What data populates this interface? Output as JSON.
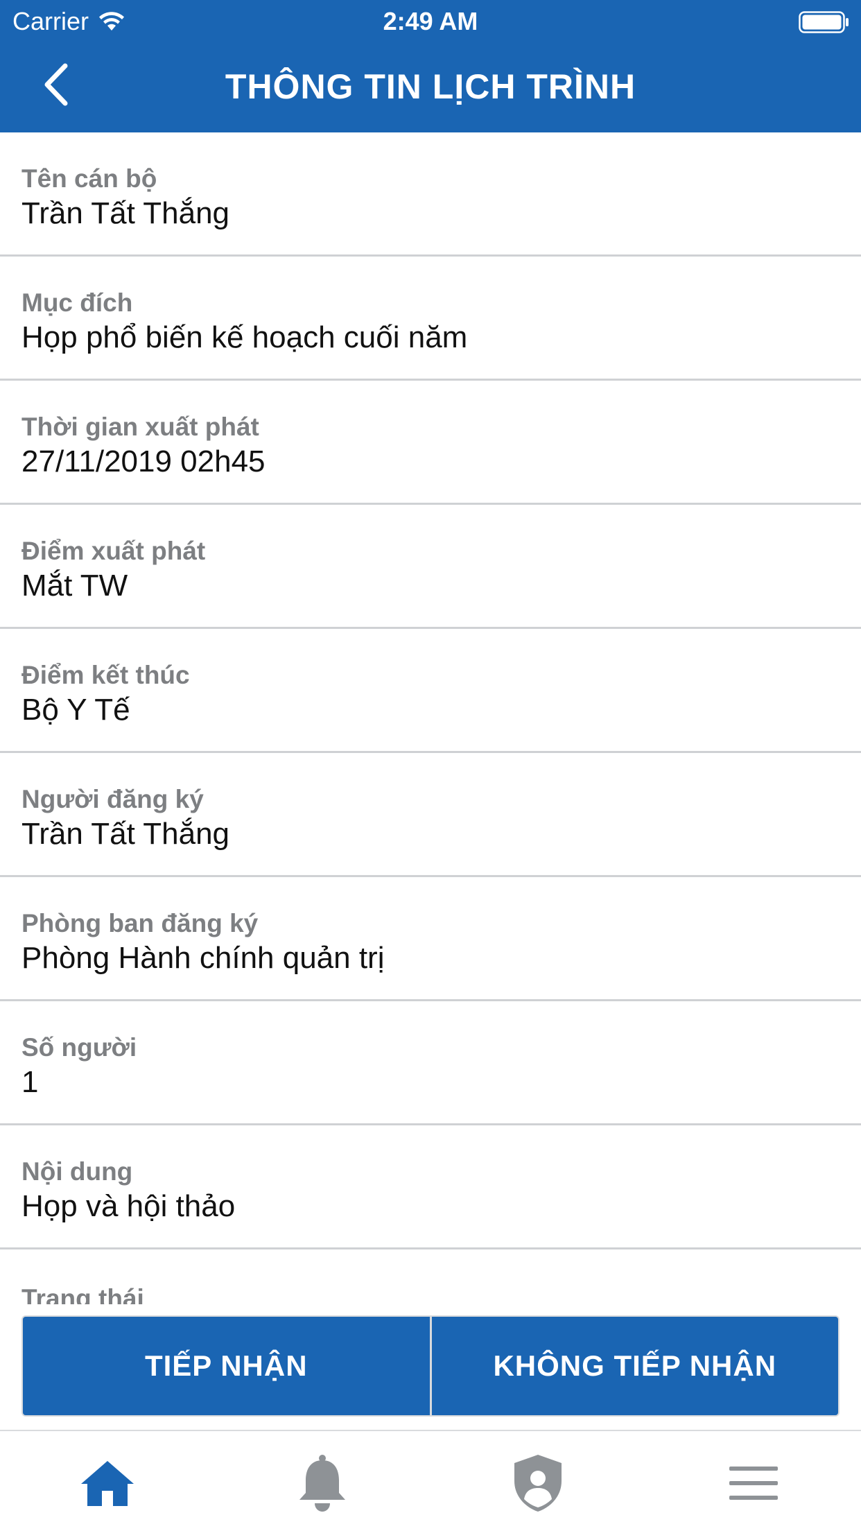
{
  "status_bar": {
    "carrier": "Carrier",
    "time": "2:49 AM"
  },
  "nav": {
    "title": "THÔNG TIN LỊCH TRÌNH"
  },
  "fields": [
    {
      "label": "Tên cán bộ",
      "value": "Trần Tất Thắng"
    },
    {
      "label": "Mục đích",
      "value": "Họp phổ biến kế hoạch cuối năm"
    },
    {
      "label": "Thời gian xuất phát",
      "value": "27/11/2019 02h45"
    },
    {
      "label": "Điểm xuất phát",
      "value": "Mắt TW"
    },
    {
      "label": "Điểm kết thúc",
      "value": "Bộ Y Tế"
    },
    {
      "label": "Người đăng ký",
      "value": "Trần Tất Thắng"
    },
    {
      "label": "Phòng ban đăng ký",
      "value": "Phòng Hành chính quản trị"
    },
    {
      "label": "Số người",
      "value": "1"
    },
    {
      "label": "Nội dung",
      "value": "Họp và hội thảo"
    },
    {
      "label": "Trạng thái",
      "value": ""
    }
  ],
  "actions": {
    "accept_label": "TIẾP NHẬN",
    "reject_label": "KHÔNG TIẾP NHẬN"
  },
  "tabs": [
    {
      "icon": "home-icon",
      "active": true
    },
    {
      "icon": "bell-icon",
      "active": false
    },
    {
      "icon": "shield-user-icon",
      "active": false
    },
    {
      "icon": "menu-icon",
      "active": false
    }
  ],
  "colors": {
    "primary": "#1a65b3",
    "label": "#7d7f82",
    "inactive_icon": "#8e9296"
  }
}
